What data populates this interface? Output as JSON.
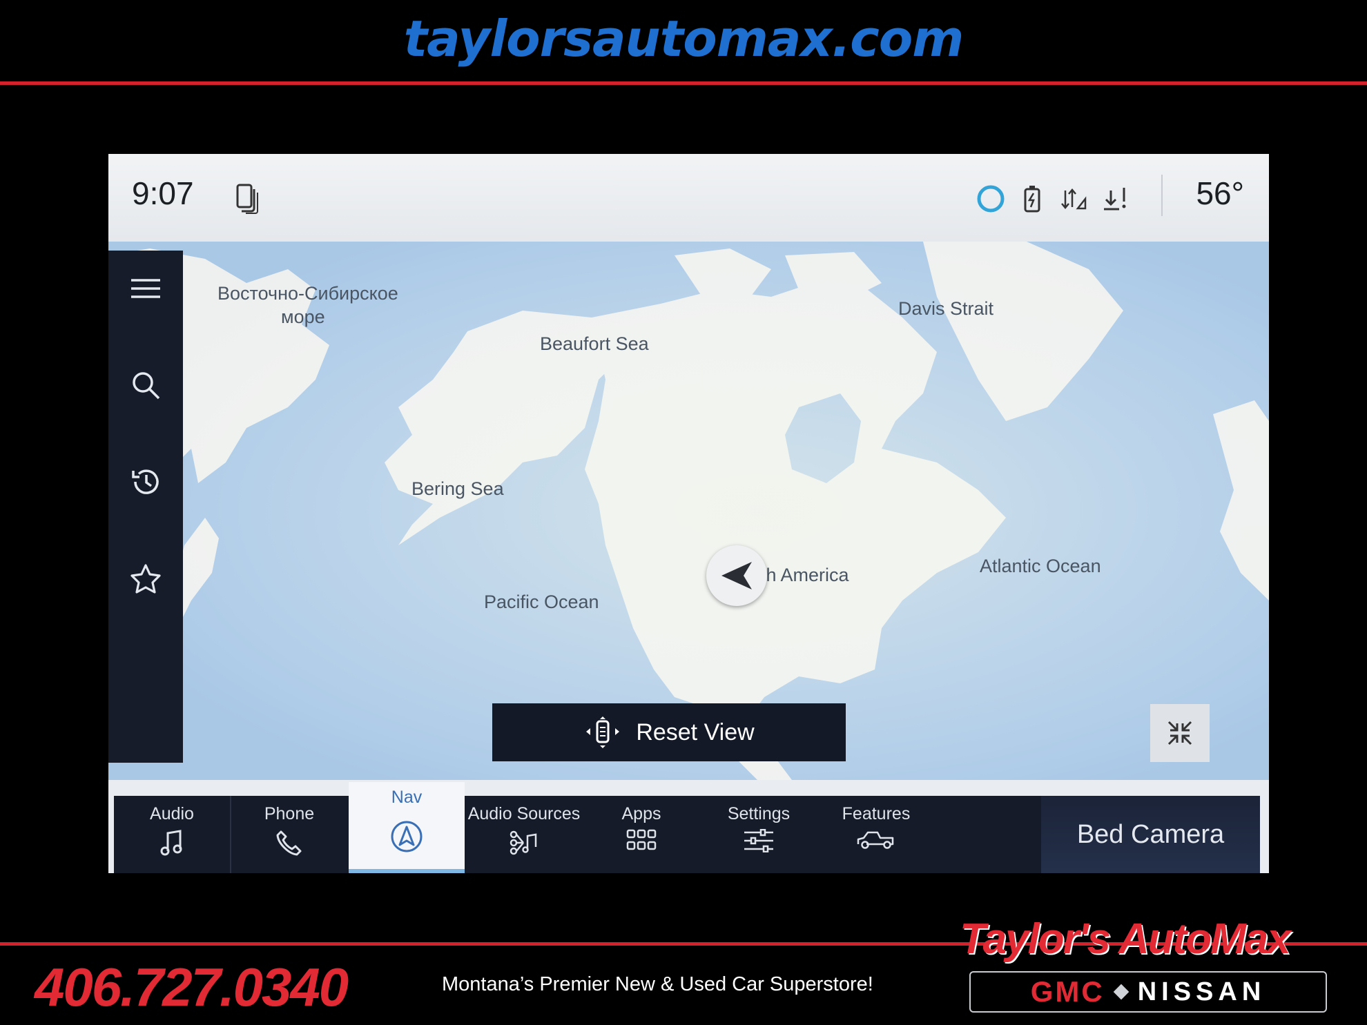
{
  "banner": {
    "website": "taylorsautomax.com"
  },
  "status_bar": {
    "time": "9:07",
    "temperature": "56°",
    "icons": [
      "phone-devices-icon",
      "alexa-ring-icon",
      "battery-charge-icon",
      "signal-icon",
      "download-alert-icon"
    ]
  },
  "map": {
    "labels": {
      "east_siberian_1": "Восточно-Сибирское",
      "east_siberian_2": "море",
      "beaufort": "Beaufort Sea",
      "davis": "Davis Strait",
      "bering": "Bering Sea",
      "pacific": "Pacific Ocean",
      "north_america": "th America",
      "atlantic": "Atlantic Ocean"
    },
    "reset_button": "Reset View",
    "sidebar_icons": [
      "menu-icon",
      "search-icon",
      "history-icon",
      "favorites-star-icon"
    ]
  },
  "nav_bar": {
    "tabs": [
      {
        "label": "Audio",
        "icon": "music-note-icon"
      },
      {
        "label": "Phone",
        "icon": "phone-handset-icon"
      },
      {
        "label": "Nav",
        "icon": "navigation-arrow-icon",
        "active": true
      },
      {
        "label": "Audio Sources",
        "icon": "audio-sources-icon"
      },
      {
        "label": "Apps",
        "icon": "apps-grid-icon"
      },
      {
        "label": "Settings",
        "icon": "sliders-icon"
      },
      {
        "label": "Features",
        "icon": "truck-icon"
      }
    ],
    "bed_camera": "Bed Camera"
  },
  "footer": {
    "phone": "406.727.0340",
    "tagline": "Montana’s Premier New & Used Car Superstore!",
    "brand": "Taylor's AutoMax",
    "gmc": "GMC",
    "nissan": "NISSAN"
  },
  "colors": {
    "brand_blue": "#1e6fd0",
    "brand_red": "#e22a35",
    "ui_dark": "#161b29"
  }
}
